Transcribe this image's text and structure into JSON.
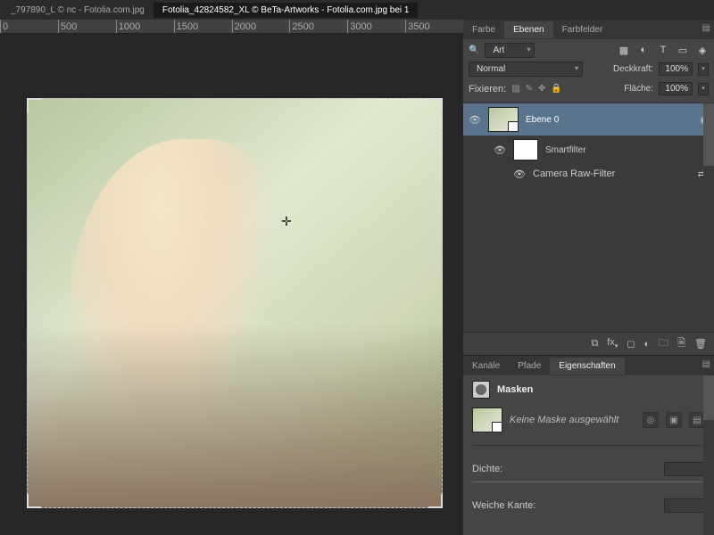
{
  "tabs": {
    "doc1": "_797890_L © nc - Fotolia.com.jpg",
    "doc2": "Fotolia_42824582_XL © BeTa-Artworks - Fotolia.com.jpg bei 1"
  },
  "ruler": {
    "vals": [
      "0",
      "500",
      "1000",
      "1500",
      "2000",
      "2500",
      "3000",
      "3500"
    ]
  },
  "panels": {
    "farbe": "Farbe",
    "ebenen": "Ebenen",
    "farbfelder": "Farbfelder",
    "kanaele": "Kanäle",
    "pfade": "Pfade",
    "eigenschaften": "Eigenschaften"
  },
  "layers": {
    "filter_kind": "Art",
    "blend_mode": "Normal",
    "opacity_label": "Deckkraft:",
    "opacity_val": "100%",
    "fill_label": "Fläche:",
    "fill_val": "100%",
    "lock_label": "Fixieren:",
    "layer0": "Ebene 0",
    "smartfilter": "Smartfilter",
    "camera_raw": "Camera Raw-Filter"
  },
  "props": {
    "title": "Masken",
    "no_mask": "Keine Maske ausgewählt",
    "dichte": "Dichte:",
    "kante": "Weiche Kante:"
  }
}
